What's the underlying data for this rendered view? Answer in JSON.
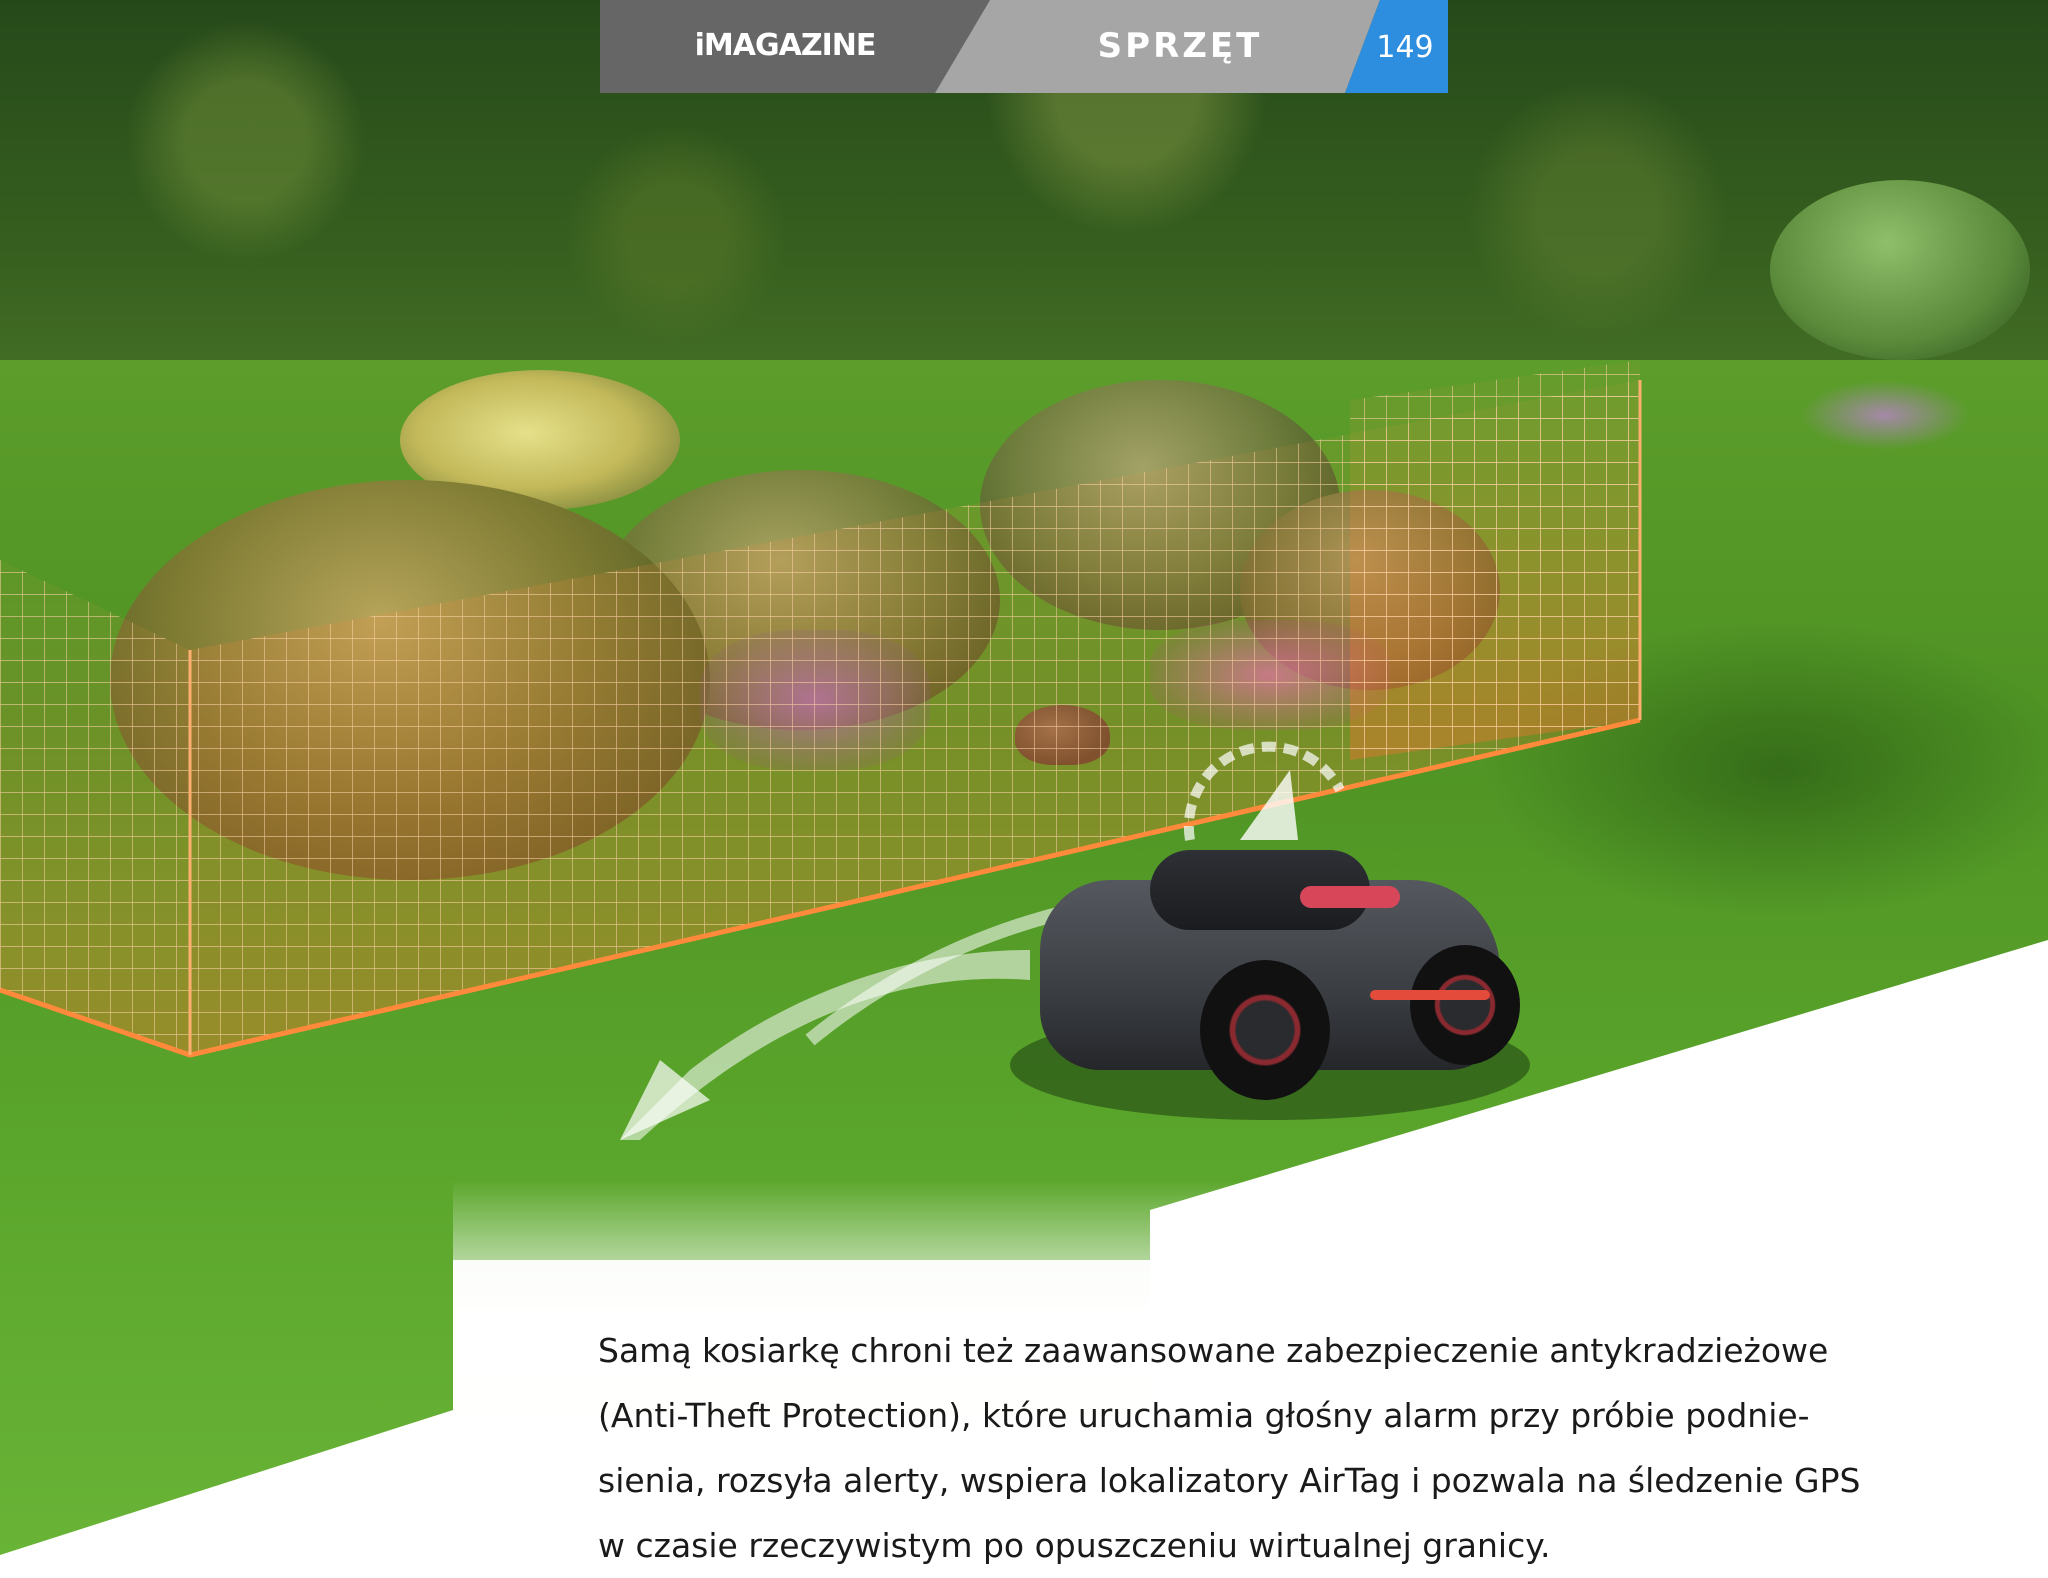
{
  "header": {
    "logo": "iMAGAZINE",
    "section": "SPRZĘT",
    "page_number": "149",
    "colors": {
      "dark": "#666666",
      "mid": "#a6a6a6",
      "accent": "#2d8ee0"
    }
  },
  "article": {
    "lines": [
      "Samą kosiarkę chroni też zaawansowane zabezpieczenie antykradzieżowe",
      "(Anti-Theft Protection), które uruchamia głośny alarm przy próbie podnie-",
      "sienia, rozsyła alerty, wspiera lokalizatory AirTag i pozwala na śledzenie GPS",
      "w czasie rzeczywistym po opuszczeniu wirtualnej granicy."
    ]
  },
  "image": {
    "icons": [
      "virtual-fence-grid",
      "robot-mower",
      "motion-arrow-icon",
      "radar-signal-icon"
    ]
  }
}
